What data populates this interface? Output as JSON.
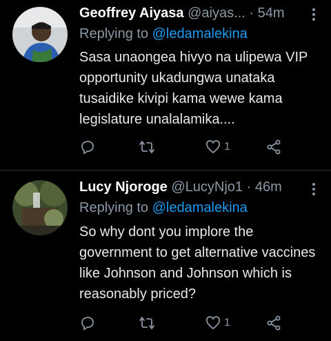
{
  "tweets": [
    {
      "name": "Geoffrey Aiyasa",
      "handle": "@aiyas...",
      "separator": "·",
      "time": "54m",
      "replying_prefix": "Replying to",
      "replying_to": "@ledamalekina",
      "text": "Sasa unaongea hivyo na ulipewa VIP opportunity ukadungwa unataka tusaidike kivipi kama wewe kama legislature unalalamika....",
      "reply_count": "",
      "retweet_count": "",
      "like_count": "1"
    },
    {
      "name": "Lucy Njoroge",
      "handle": "@LucyNjo1",
      "separator": "·",
      "time": "46m",
      "replying_prefix": "Replying to",
      "replying_to": "@ledamalekina",
      "text": "So why dont you implore the government to get alternative vaccines like Johnson and Johnson which is reasonably priced?",
      "reply_count": "",
      "retweet_count": "",
      "like_count": "1"
    }
  ],
  "icons": {
    "reply": "reply-icon",
    "retweet": "retweet-icon",
    "like": "heart-icon",
    "share": "share-icon",
    "more": "more-vertical-icon"
  },
  "colors": {
    "background": "#000000",
    "link": "#1d9bf0",
    "muted": "#8b98a5",
    "text": "#e7e9ea"
  }
}
